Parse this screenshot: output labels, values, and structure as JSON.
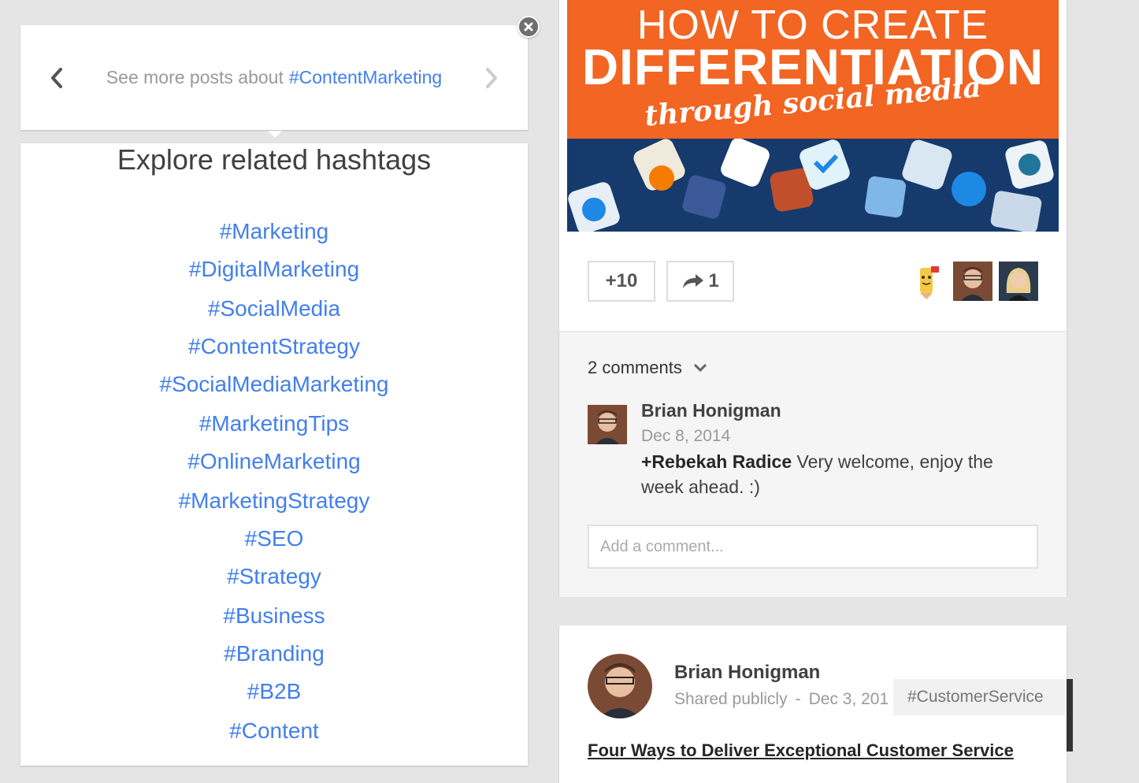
{
  "see_more": {
    "prefix": "See more posts about",
    "hashtag": "#ContentMarketing"
  },
  "related": {
    "heading": "Explore related hashtags",
    "hashtags": [
      "#Marketing",
      "#DigitalMarketing",
      "#SocialMedia",
      "#ContentStrategy",
      "#SocialMediaMarketing",
      "#MarketingTips",
      "#OnlineMarketing",
      "#MarketingStrategy",
      "#SEO",
      "#Strategy",
      "#Business",
      "#Branding",
      "#B2B",
      "#Content"
    ]
  },
  "post1": {
    "banner": {
      "line1": "HOW TO CREATE",
      "line2": "DIFFERENTIATION",
      "line3": "through social media"
    },
    "plus_count": "+10",
    "share_count": "1",
    "comments_label": "2 comments",
    "comment": {
      "author": "Brian Honigman",
      "date": "Dec 8, 2014",
      "mention": "+Rebekah Radice",
      "text": " Very welcome, enjoy the week ahead. :)"
    },
    "add_comment_placeholder": "Add a comment..."
  },
  "post2": {
    "author": "Brian Honigman",
    "visibility": "Shared publicly",
    "separator": "-",
    "date": "Dec 3, 201",
    "title": "Four Ways to Deliver Exceptional Customer Service"
  },
  "tag_chip": "#CustomerService",
  "colors": {
    "link_blue": "#427fed",
    "banner_orange": "#f26522",
    "background": "#e5e5e5"
  }
}
